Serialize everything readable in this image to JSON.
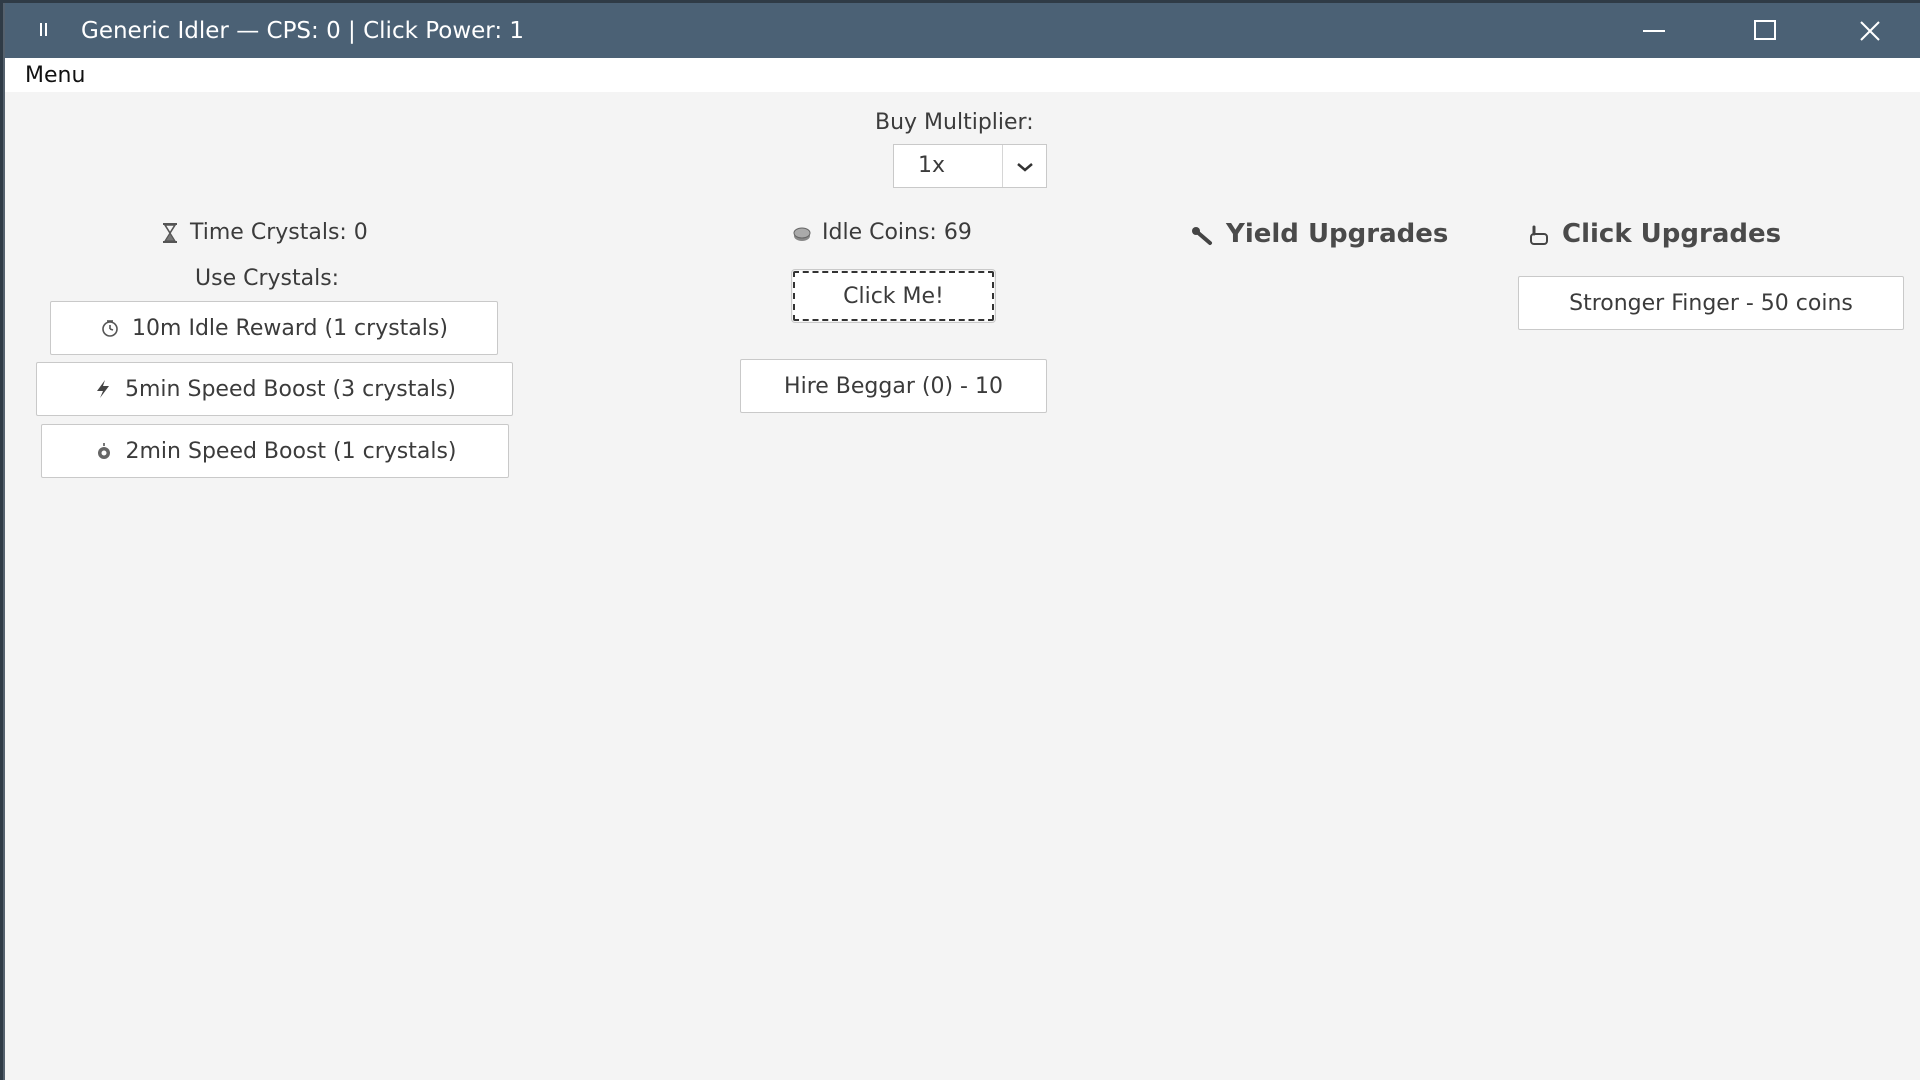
{
  "window": {
    "title": "Generic Idler — CPS: 0 | Click Power: 1"
  },
  "menubar": {
    "menu_label": "Menu"
  },
  "buy_multiplier": {
    "label": "Buy Multiplier:",
    "selected": "1x"
  },
  "crystals": {
    "label": "Time Crystals: 0",
    "use_label": "Use Crystals:",
    "buttons": [
      {
        "label": "10m Idle Reward (1 crystals)",
        "icon": "clock-icon"
      },
      {
        "label": "5min Speed Boost (3 crystals)",
        "icon": "lightning-icon"
      },
      {
        "label": "2min Speed Boost (1 crystals)",
        "icon": "rocket-icon"
      }
    ]
  },
  "coins": {
    "label": "Idle Coins: 69",
    "click_button": "Click Me!",
    "hire_button": "Hire Beggar (0) - 10"
  },
  "yield_upgrades": {
    "heading": "Yield Upgrades"
  },
  "click_upgrades": {
    "heading": "Click Upgrades",
    "items": [
      {
        "label": "Stronger Finger - 50 coins"
      }
    ]
  },
  "colors": {
    "titlebar": "#4b6175",
    "background": "#f4f4f4",
    "button_border": "#c9c9c9"
  }
}
